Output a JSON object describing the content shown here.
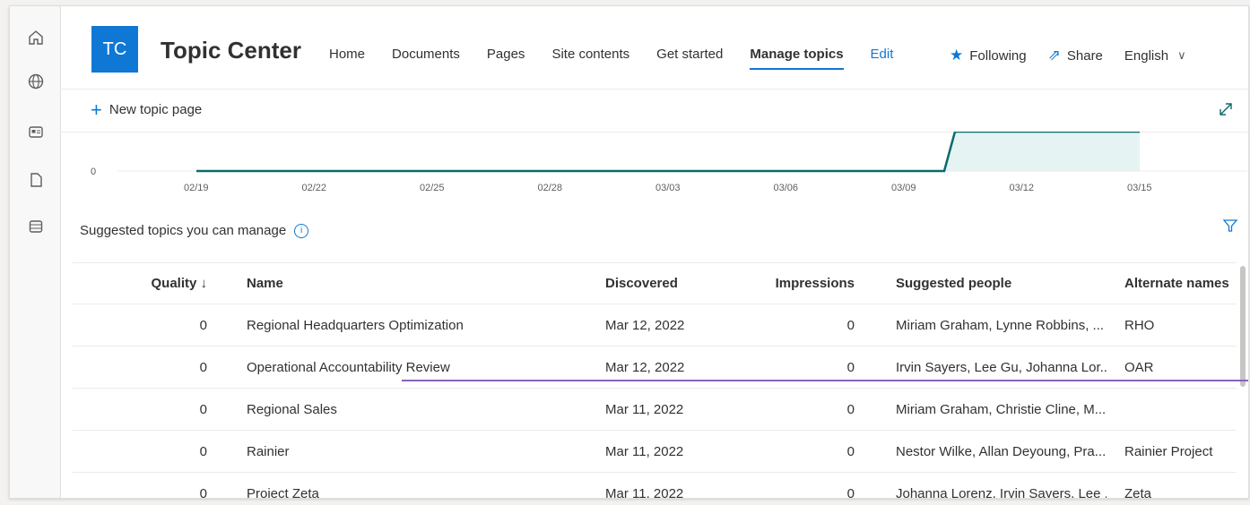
{
  "site": {
    "logo_text": "TC",
    "title": "Topic Center"
  },
  "nav": [
    {
      "label": "Home"
    },
    {
      "label": "Documents"
    },
    {
      "label": "Pages"
    },
    {
      "label": "Site contents"
    },
    {
      "label": "Get started"
    },
    {
      "label": "Manage topics",
      "active": true
    },
    {
      "label": "Edit"
    }
  ],
  "header_actions": {
    "following": "Following",
    "share": "Share",
    "language": "English"
  },
  "command_bar": {
    "new_topic": "New topic page"
  },
  "chart_data": {
    "type": "line",
    "x": [
      "02/19",
      "02/22",
      "02/25",
      "02/28",
      "03/03",
      "03/06",
      "03/09",
      "03/12",
      "03/15"
    ],
    "y_tick": "0",
    "series": [
      {
        "points": [
          [
            "02/19",
            0
          ],
          [
            "02/22",
            0
          ],
          [
            "02/25",
            0
          ],
          [
            "02/28",
            0
          ],
          [
            "03/03",
            0
          ],
          [
            "03/06",
            0
          ],
          [
            "03/09",
            0
          ],
          [
            "03/10",
            0
          ],
          [
            "03/11",
            1
          ],
          [
            "03/12",
            1
          ],
          [
            "03/15",
            1
          ]
        ]
      }
    ]
  },
  "section": {
    "title": "Suggested topics you can manage",
    "info_icon": "info-icon",
    "filter_icon": "filter-icon"
  },
  "table": {
    "headers": {
      "quality": "Quality ↓",
      "name": "Name",
      "discovered": "Discovered",
      "impressions": "Impressions",
      "people": "Suggested people",
      "alternate": "Alternate names"
    },
    "rows": [
      {
        "quality": "0",
        "name": "Regional Headquarters Optimization",
        "discovered": "Mar 12, 2022",
        "impressions": "0",
        "people": "Miriam Graham, Lynne Robbins, ...",
        "alternate": "RHO"
      },
      {
        "quality": "0",
        "name": "Operational Accountability Review",
        "discovered": "Mar 12, 2022",
        "impressions": "0",
        "people": "Irvin Sayers, Lee Gu, Johanna Lor...",
        "alternate": "OAR"
      },
      {
        "quality": "0",
        "name": "Regional Sales",
        "discovered": "Mar 11, 2022",
        "impressions": "0",
        "people": "Miriam Graham, Christie Cline, M...",
        "alternate": ""
      },
      {
        "quality": "0",
        "name": "Rainier",
        "discovered": "Mar 11, 2022",
        "impressions": "0",
        "people": "Nestor Wilke, Allan Deyoung, Pra...",
        "alternate": "Rainier Project"
      },
      {
        "quality": "0",
        "name": "Project Zeta",
        "discovered": "Mar 11, 2022",
        "impressions": "0",
        "people": "Johanna Lorenz, Irvin Sayers, Lee ...",
        "alternate": "Zeta"
      }
    ]
  },
  "colors": {
    "accent": "#0f78d4",
    "chart_line": "#0b6a6a",
    "chart_fill": "#e6f3f3",
    "highlight": "#8764b8"
  }
}
